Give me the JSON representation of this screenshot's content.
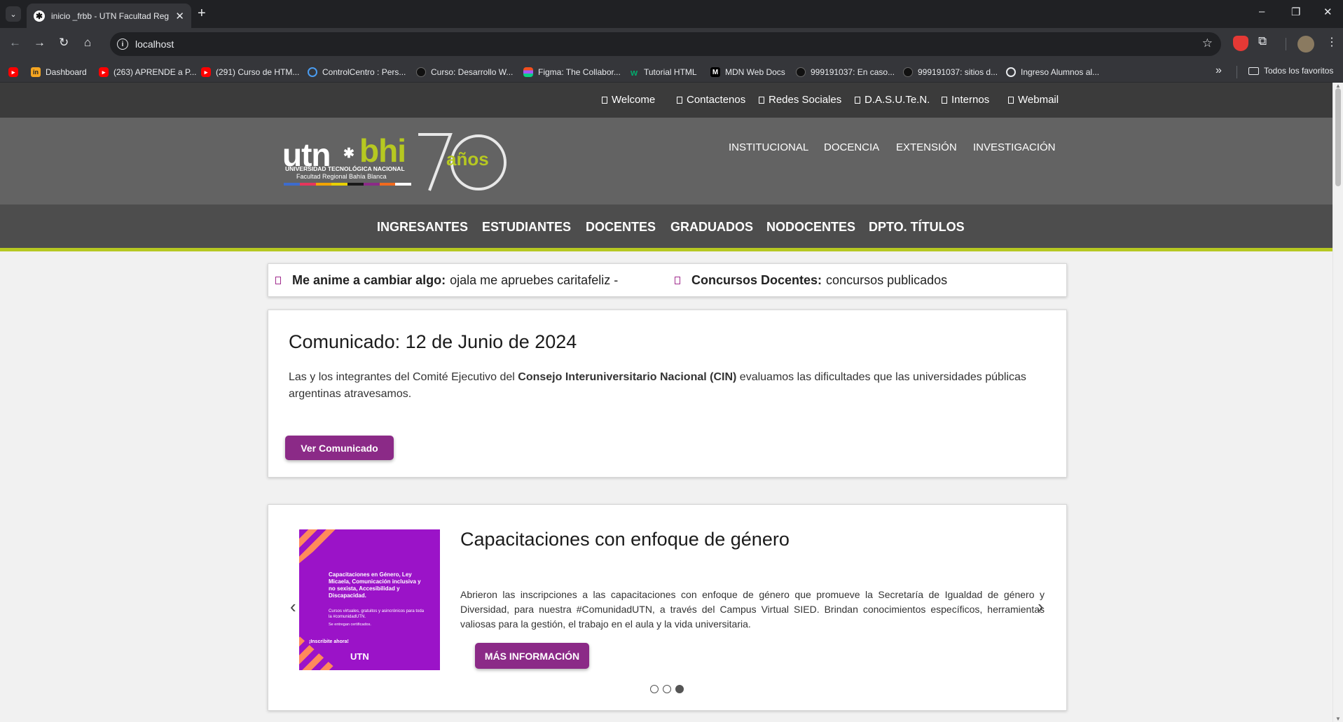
{
  "browser": {
    "tab_title": "inicio _frbb - UTN Facultad Reg",
    "url": "localhost",
    "bookmarks": [
      {
        "label": "",
        "icon": "youtube-icon"
      },
      {
        "label": "Dashboard",
        "icon": "aprende-icon"
      },
      {
        "label": "(263) APRENDE a P...",
        "icon": "youtube-icon"
      },
      {
        "label": "(291) Curso de HTM...",
        "icon": "youtube-icon"
      },
      {
        "label": "ControlCentro : Pers...",
        "icon": "cc-icon"
      },
      {
        "label": "Curso: Desarrollo W...",
        "icon": "moodle-icon"
      },
      {
        "label": "Figma: The Collabor...",
        "icon": "figma-icon"
      },
      {
        "label": "Tutorial HTML",
        "icon": "w3-icon"
      },
      {
        "label": "MDN Web Docs",
        "icon": "mdn-icon"
      },
      {
        "label": "999191037: En caso...",
        "icon": "moodle-icon"
      },
      {
        "label": "999191037: sitios d...",
        "icon": "moodle-icon"
      },
      {
        "label": "Ingreso Alumnos al...",
        "icon": "globe-icon"
      }
    ],
    "all_bookmarks": "Todos los favoritos"
  },
  "site": {
    "top_links": [
      "Welcome",
      "Contactenos",
      "Redes Sociales",
      "D.A.S.U.Te.N.",
      "Internos",
      "Webmail"
    ],
    "logo": {
      "utn": "utn",
      "bhi": "bhi",
      "subtitle1": "UNIVERSIDAD TECNOLÓGICA NACIONAL",
      "subtitle2": "Facultad Regional Bahía Blanca",
      "anos": "años"
    },
    "main_links": [
      "INSTITUCIONAL",
      "DOCENCIA",
      "EXTENSIÓN",
      "INVESTIGACIÓN"
    ],
    "nav_links": [
      "INGRESANTES",
      "ESTUDIANTES",
      "DOCENTES",
      "GRADUADOS",
      "NODOCENTES",
      "DPTO. TÍTULOS"
    ],
    "ticker": [
      {
        "label": "Me anime a cambiar algo:",
        "text": "ojala me apruebes caritafeliz -"
      },
      {
        "label": "Concursos Docentes:",
        "text": "concursos publicados"
      }
    ],
    "comunicado": {
      "title": "Comunicado: 12 de Junio de 2024",
      "body_pre": "Las y los integrantes del Comité Ejecutivo del ",
      "body_bold": "Consejo Interuniversitario Nacional (CIN)",
      "body_post": " evaluamos las dificultades que las universidades públicas argentinas atravesamos.",
      "button": "Ver Comunicado"
    },
    "carousel": {
      "image_text": {
        "heading": "Capacitaciones en Género, Ley Micaela, Comunicación inclusiva y no sexista, Accesibilidad y Discapacidad.",
        "sub": "Cursos virtuales, gratuitos y asincrónicos para toda la #comunidadUTN.",
        "cert": "Se entregan certificados.",
        "cta": "¡Inscribite ahora!",
        "brand": "UTN"
      },
      "title": "Capacitaciones con enfoque de género",
      "body": "Abrieron las inscripciones a las capacitaciones con enfoque de género que promueve la Secretaría de Igualdad de género y Diversidad, para nuestra #ComunidadUTN, a través del Campus Virtual SIED. Brindan conocimientos específicos, herramientas valiosas para la gestión, el trabajo en el aula y la vida universitaria.",
      "button": "MÁS INFORMACIÓN",
      "active_slide": 3,
      "slide_count": 3
    }
  },
  "colors": {
    "accent_green": "#b6c821",
    "button_purple": "#8b2a87",
    "slide_purple": "#9b13c8"
  }
}
